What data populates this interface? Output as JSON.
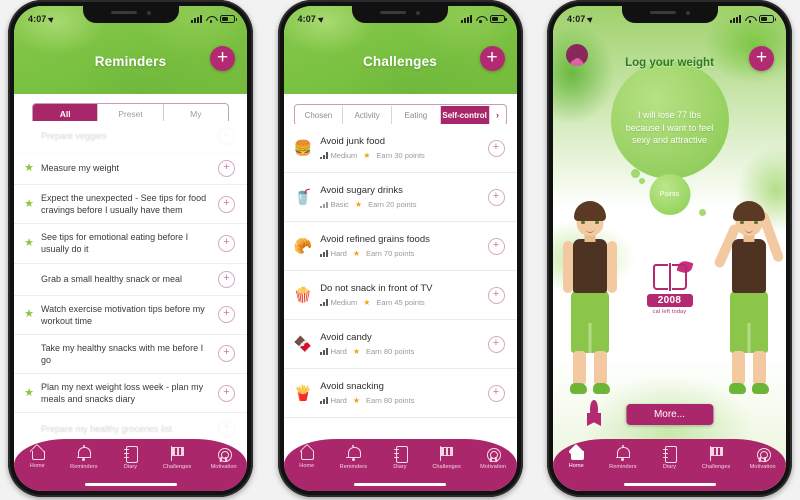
{
  "status_bar": {
    "time": "4:07",
    "location_icon": "location-arrow-icon",
    "signal_icon": "signal-bars-icon",
    "wifi_icon": "wifi-icon",
    "battery_icon": "battery-icon"
  },
  "phone1": {
    "header": {
      "title": "Reminders",
      "add_label": "+"
    },
    "segments": [
      {
        "label": "All",
        "active": true
      },
      {
        "label": "Preset",
        "active": false
      },
      {
        "label": "My",
        "active": false
      }
    ],
    "items": [
      {
        "text": "Prepare veggies",
        "star": false,
        "faded": true
      },
      {
        "text": "Measure my weight",
        "star": true,
        "faded": false
      },
      {
        "text": "Expect the unexpected - See tips for food cravings before I usually have them",
        "star": true,
        "faded": false
      },
      {
        "text": "See tips for emotional eating before I usually do it",
        "star": true,
        "faded": false
      },
      {
        "text": "Grab a small healthy snack or meal",
        "star": false,
        "faded": false
      },
      {
        "text": "Watch exercise motivation tips before my workout time",
        "star": true,
        "faded": false
      },
      {
        "text": "Take my healthy snacks with me before I go",
        "star": false,
        "faded": false
      },
      {
        "text": "Plan my next weight loss week - plan my meals and snacks diary",
        "star": true,
        "faded": false
      },
      {
        "text": "Prepare my healthy groceries list",
        "star": false,
        "faded": true
      }
    ]
  },
  "phone2": {
    "header": {
      "title": "Challenges",
      "add_label": "+"
    },
    "chips": [
      {
        "label": "Chosen",
        "active": false
      },
      {
        "label": "Activity",
        "active": false
      },
      {
        "label": "Eating",
        "active": false
      },
      {
        "label": "Self-control",
        "active": true
      }
    ],
    "chip_next": "›",
    "challenges": [
      {
        "icon": "burger-icon",
        "emoji": "🍔",
        "title": "Avoid junk food",
        "level": "Medium",
        "points": "Earn 30 points"
      },
      {
        "icon": "soda-bottle-icon",
        "emoji": "🥤",
        "title": "Avoid sugary drinks",
        "level": "Basic",
        "points": "Earn 20 points"
      },
      {
        "icon": "croissant-icon",
        "emoji": "🥐",
        "title": "Avoid refined grains foods",
        "level": "Hard",
        "points": "Earn 70 points"
      },
      {
        "icon": "popcorn-icon",
        "emoji": "🍿",
        "title": "Do not snack in front of TV",
        "level": "Medium",
        "points": "Earn 45 points"
      },
      {
        "icon": "chocolate-icon",
        "emoji": "🍫",
        "title": "Avoid candy",
        "level": "Hard",
        "points": "Earn 80 points"
      },
      {
        "icon": "fries-icon",
        "emoji": "🍟",
        "title": "Avoid snacking",
        "level": "Hard",
        "points": "Earn 80 points"
      }
    ]
  },
  "phone3": {
    "avatar_icon": "profile-avatar-icon",
    "add_label": "+",
    "log_weight_title": "Log your weight",
    "goal_text": "I will lose 77 lbs because I want to feel sexy and attractive",
    "points_label": "Points",
    "calories_value": "2008",
    "calories_caption": "cal left today",
    "more_label": "More...",
    "diary_icon": "diary-book-quill-icon",
    "ribbon_icon": "ribbon-icon"
  },
  "tabbar": {
    "items": [
      {
        "label": "Home",
        "icon": "home-icon"
      },
      {
        "label": "Reminders",
        "icon": "bell-icon"
      },
      {
        "label": "Diary",
        "icon": "notebook-icon"
      },
      {
        "label": "Challenges",
        "icon": "flag-icon"
      },
      {
        "label": "Motivation",
        "icon": "medal-icon"
      }
    ],
    "active_index_phone3": 0
  },
  "colors": {
    "magenta": "#ab276b",
    "green": "#7cc242",
    "star_green": "#8cc63e",
    "points_star": "#f0a019"
  }
}
